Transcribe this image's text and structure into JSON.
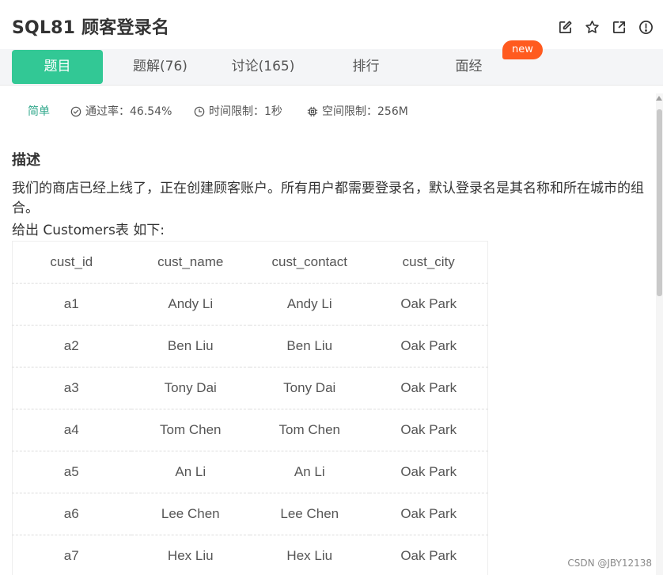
{
  "problem": {
    "title": "SQL81  顾客登录名"
  },
  "header_icons": [
    "edit-icon",
    "star-icon",
    "external-link-icon",
    "alert-icon"
  ],
  "tabs": [
    {
      "label": "题目",
      "active": true
    },
    {
      "label": "题解(76)",
      "active": false
    },
    {
      "label": "讨论(165)",
      "active": false
    },
    {
      "label": "排行",
      "active": false
    },
    {
      "label": "面经",
      "active": false
    }
  ],
  "badge": {
    "label": "new"
  },
  "info": {
    "difficulty": "简单",
    "pass_rate": "通过率：46.54%",
    "time_limit": "时间限制：1秒",
    "memory_limit": "空间限制：256M"
  },
  "description": {
    "heading": "描述",
    "paragraph": "我们的商店已经上线了，正在创建顾客账户。所有用户都需要登录名，默认登录名是其名称和所在城市的组合。",
    "table_intro": "给出 Customers表 如下:"
  },
  "table": {
    "columns": [
      "cust_id",
      "cust_name",
      "cust_contact",
      "cust_city"
    ],
    "rows": [
      [
        "a1",
        "Andy Li",
        "Andy Li",
        "Oak Park"
      ],
      [
        "a2",
        "Ben Liu",
        "Ben Liu",
        "Oak Park"
      ],
      [
        "a3",
        "Tony Dai",
        "Tony Dai",
        "Oak Park"
      ],
      [
        "a4",
        "Tom Chen",
        "Tom Chen",
        "Oak Park"
      ],
      [
        "a5",
        "An Li",
        "An Li",
        "Oak Park"
      ],
      [
        "a6",
        "Lee Chen",
        "Lee Chen",
        "Oak Park"
      ],
      [
        "a7",
        "Hex Liu",
        "Hex Liu",
        "Oak Park"
      ]
    ]
  },
  "watermark": "CSDN @JBY12138",
  "colors": {
    "accent": "#32c895",
    "badge": "#ff5a1f",
    "difficulty": "#32a88c"
  }
}
